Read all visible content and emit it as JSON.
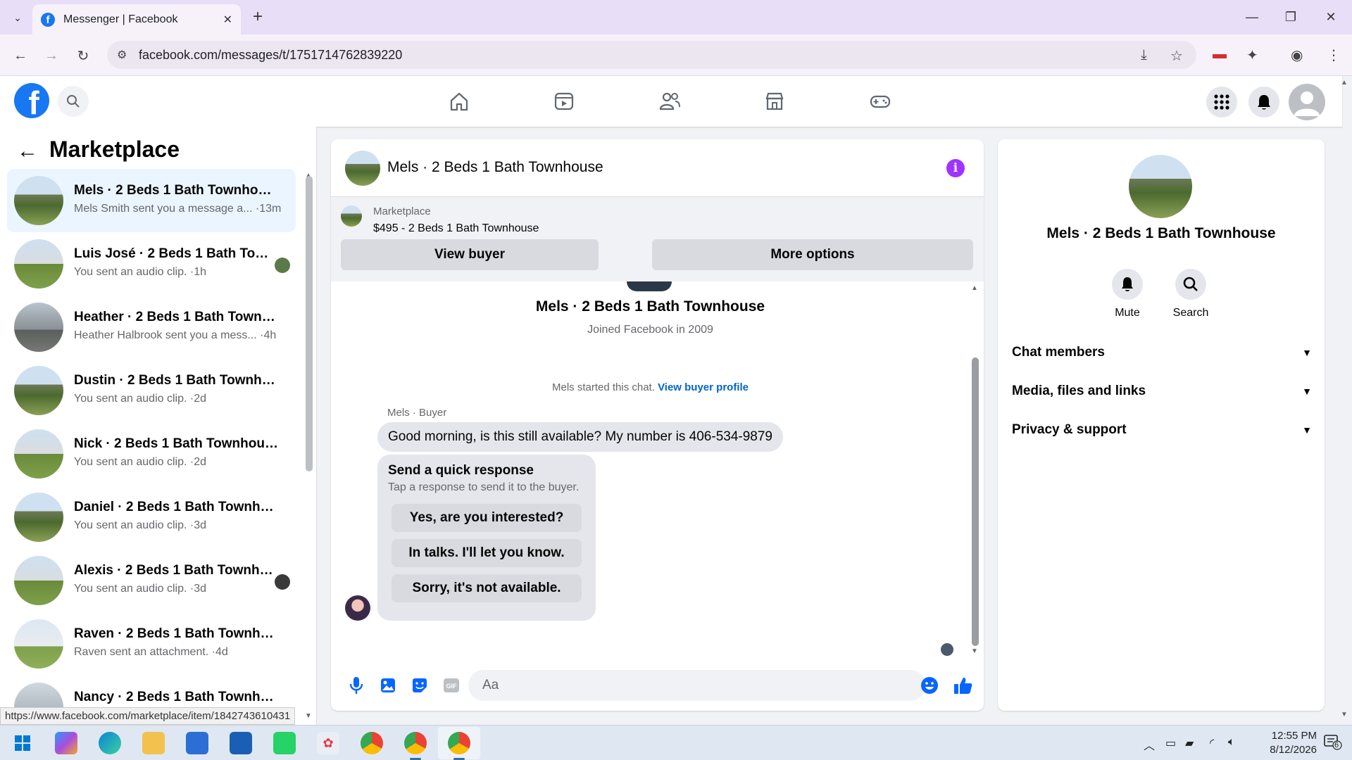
{
  "browser": {
    "tab_title": "Messenger | Facebook",
    "url": "facebook.com/messages/t/1751714762839220",
    "status_url": "https://www.facebook.com/marketplace/item/1842743610431"
  },
  "left_pane": {
    "title": "Marketplace",
    "conversations": [
      {
        "name": "Mels · 2 Beds 1 Bath Townhouse",
        "preview": "Mels Smith sent you a message a... ·13m",
        "active": true
      },
      {
        "name": "Luis José · 2 Beds 1 Bath Town...",
        "preview": "You sent an audio clip. ·1h"
      },
      {
        "name": "Heather · 2 Beds 1 Bath Townho...",
        "preview": "Heather Halbrook sent you a mess... ·4h"
      },
      {
        "name": "Dustin · 2 Beds 1 Bath Townhouse",
        "preview": "You sent an audio clip. ·2d"
      },
      {
        "name": "Nick · 2 Beds 1 Bath Townhouse",
        "preview": "You sent an audio clip. ·2d"
      },
      {
        "name": "Daniel · 2 Beds 1 Bath Townhouse",
        "preview": "You sent an audio clip. ·3d"
      },
      {
        "name": "Alexis · 2 Beds 1 Bath Townho...",
        "preview": "You sent an audio clip. ·3d"
      },
      {
        "name": "Raven · 2 Beds 1 Bath Townhouse",
        "preview": "Raven sent an attachment. ·4d"
      },
      {
        "name": "Nancy · 2 Beds 1 Bath Townhouse",
        "preview": ""
      }
    ]
  },
  "chat": {
    "header_title": "Mels · 2 Beds 1 Bath Townhouse",
    "listing_label": "Marketplace",
    "listing_price": "$495 - 2 Beds 1 Bath Townhouse",
    "view_buyer": "View buyer",
    "more_options": "More options",
    "intro_title": "Mels · 2 Beds 1 Bath Townhouse",
    "joined": "Joined Facebook in 2009",
    "started_text": "Mels started this chat.",
    "view_profile": "View buyer profile",
    "sender_label": "Mels · Buyer",
    "message": "Good morning, is this still available? My number is 406-534-9879",
    "quick_title": "Send a quick response",
    "quick_sub": "Tap a response to send it to the buyer.",
    "quick_responses": [
      "Yes, are you interested?",
      "In talks. I'll let you know.",
      "Sorry, it's not available."
    ],
    "input_placeholder": "Aa"
  },
  "right_panel": {
    "name": "Mels · 2 Beds 1 Bath Townhouse",
    "mute": "Mute",
    "search": "Search",
    "sections": [
      "Chat members",
      "Media, files and links",
      "Privacy & support"
    ]
  },
  "taskbar": {
    "time": "12:55 PM",
    "date": "8/12/2026",
    "notifications": "6"
  },
  "colors": {
    "fb_blue": "#1877f2",
    "active_conv_bg": "#ebf5ff",
    "info_purple": "#a033ff",
    "link_blue": "#0064d1"
  }
}
